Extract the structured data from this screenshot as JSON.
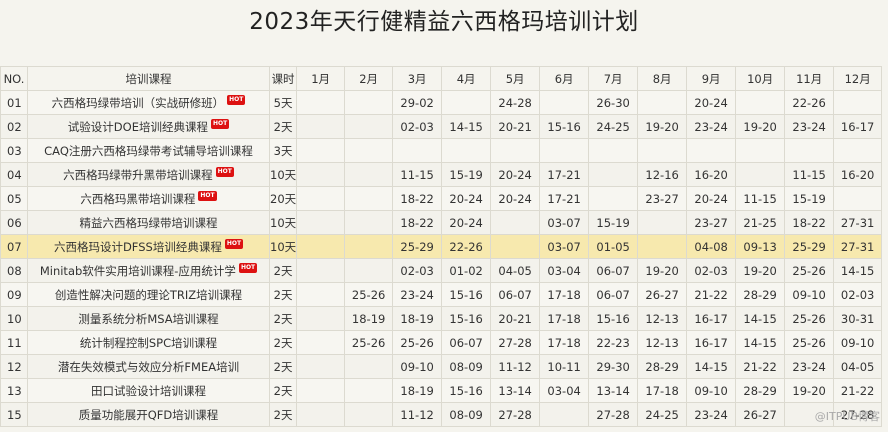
{
  "title": "2023年天行健精益六西格玛培训计划",
  "headers": [
    "NO.",
    "培训课程",
    "课时",
    "1月",
    "2月",
    "3月",
    "4月",
    "5月",
    "6月",
    "7月",
    "8月",
    "9月",
    "10月",
    "11月",
    "12月"
  ],
  "hot_label": "HOT",
  "rows": [
    {
      "no": "01",
      "course": "六西格玛绿带培训（实战研修班）",
      "hot": true,
      "hours": "5天",
      "m": [
        "",
        "",
        "29-02",
        "",
        "24-28",
        "",
        "26-30",
        "",
        "20-24",
        "",
        "22-26",
        ""
      ]
    },
    {
      "no": "02",
      "course": "试验设计DOE培训经典课程",
      "hot": true,
      "hours": "2天",
      "m": [
        "",
        "",
        "02-03",
        "14-15",
        "20-21",
        "15-16",
        "24-25",
        "19-20",
        "23-24",
        "19-20",
        "23-24",
        "16-17"
      ]
    },
    {
      "no": "03",
      "course": "CAQ注册六西格玛绿带考试辅导培训课程",
      "hot": false,
      "hours": "3天",
      "m": [
        "",
        "",
        "",
        "",
        "",
        "",
        "",
        "",
        "",
        "",
        "",
        ""
      ]
    },
    {
      "no": "04",
      "course": "六西格玛绿带升黑带培训课程",
      "hot": true,
      "hours": "10天",
      "m": [
        "",
        "",
        "11-15",
        "15-19",
        "20-24",
        "17-21",
        "",
        "12-16",
        "16-20",
        "",
        "11-15",
        "16-20"
      ]
    },
    {
      "no": "05",
      "course": "六西格玛黑带培训课程",
      "hot": true,
      "hours": "20天",
      "m": [
        "",
        "",
        "18-22",
        "20-24",
        "20-24",
        "17-21",
        "",
        "23-27",
        "20-24",
        "11-15",
        "15-19",
        ""
      ]
    },
    {
      "no": "06",
      "course": "精益六西格玛绿带培训课程",
      "hot": false,
      "hours": "10天",
      "m": [
        "",
        "",
        "18-22",
        "20-24",
        "",
        "03-07",
        "15-19",
        "",
        "23-27",
        "21-25",
        "18-22",
        "27-31"
      ]
    },
    {
      "no": "07",
      "course": "六西格玛设计DFSS培训经典课程",
      "hot": true,
      "hours": "10天",
      "m": [
        "",
        "",
        "25-29",
        "22-26",
        "",
        "03-07",
        "01-05",
        "",
        "04-08",
        "09-13",
        "25-29",
        "27-31"
      ]
    },
    {
      "no": "08",
      "course": "Minitab软件实用培训课程-应用统计学",
      "hot": true,
      "hours": "2天",
      "m": [
        "",
        "",
        "02-03",
        "01-02",
        "04-05",
        "03-04",
        "06-07",
        "19-20",
        "02-03",
        "19-20",
        "25-26",
        "14-15"
      ]
    },
    {
      "no": "09",
      "course": "创造性解决问题的理论TRIZ培训课程",
      "hot": false,
      "hours": "2天",
      "m": [
        "",
        "25-26",
        "23-24",
        "15-16",
        "06-07",
        "17-18",
        "06-07",
        "26-27",
        "21-22",
        "28-29",
        "09-10",
        "02-03"
      ]
    },
    {
      "no": "10",
      "course": "测量系统分析MSA培训课程",
      "hot": false,
      "hours": "2天",
      "m": [
        "",
        "18-19",
        "18-19",
        "15-16",
        "20-21",
        "17-18",
        "15-16",
        "12-13",
        "16-17",
        "14-15",
        "25-26",
        "30-31"
      ]
    },
    {
      "no": "11",
      "course": "统计制程控制SPC培训课程",
      "hot": false,
      "hours": "2天",
      "m": [
        "",
        "25-26",
        "25-26",
        "06-07",
        "27-28",
        "17-18",
        "22-23",
        "12-13",
        "16-17",
        "14-15",
        "25-26",
        "09-10"
      ]
    },
    {
      "no": "12",
      "course": "潜在失效模式与效应分析FMEA培训",
      "hot": false,
      "hours": "2天",
      "m": [
        "",
        "",
        "09-10",
        "08-09",
        "11-12",
        "10-11",
        "29-30",
        "28-29",
        "14-15",
        "21-22",
        "23-24",
        "04-05"
      ]
    },
    {
      "no": "13",
      "course": "田口试验设计培训课程",
      "hot": false,
      "hours": "2天",
      "m": [
        "",
        "",
        "18-19",
        "15-16",
        "13-14",
        "03-04",
        "13-14",
        "17-18",
        "09-10",
        "28-29",
        "19-20",
        "21-22"
      ]
    },
    {
      "no": "15",
      "course": "质量功能展开QFD培训课程",
      "hot": false,
      "hours": "2天",
      "m": [
        "",
        "",
        "11-12",
        "08-09",
        "27-28",
        "",
        "27-28",
        "24-25",
        "23-24",
        "26-27",
        "",
        "27-28"
      ]
    }
  ],
  "highlight_row": "07",
  "watermark": "@ITPUB博客"
}
